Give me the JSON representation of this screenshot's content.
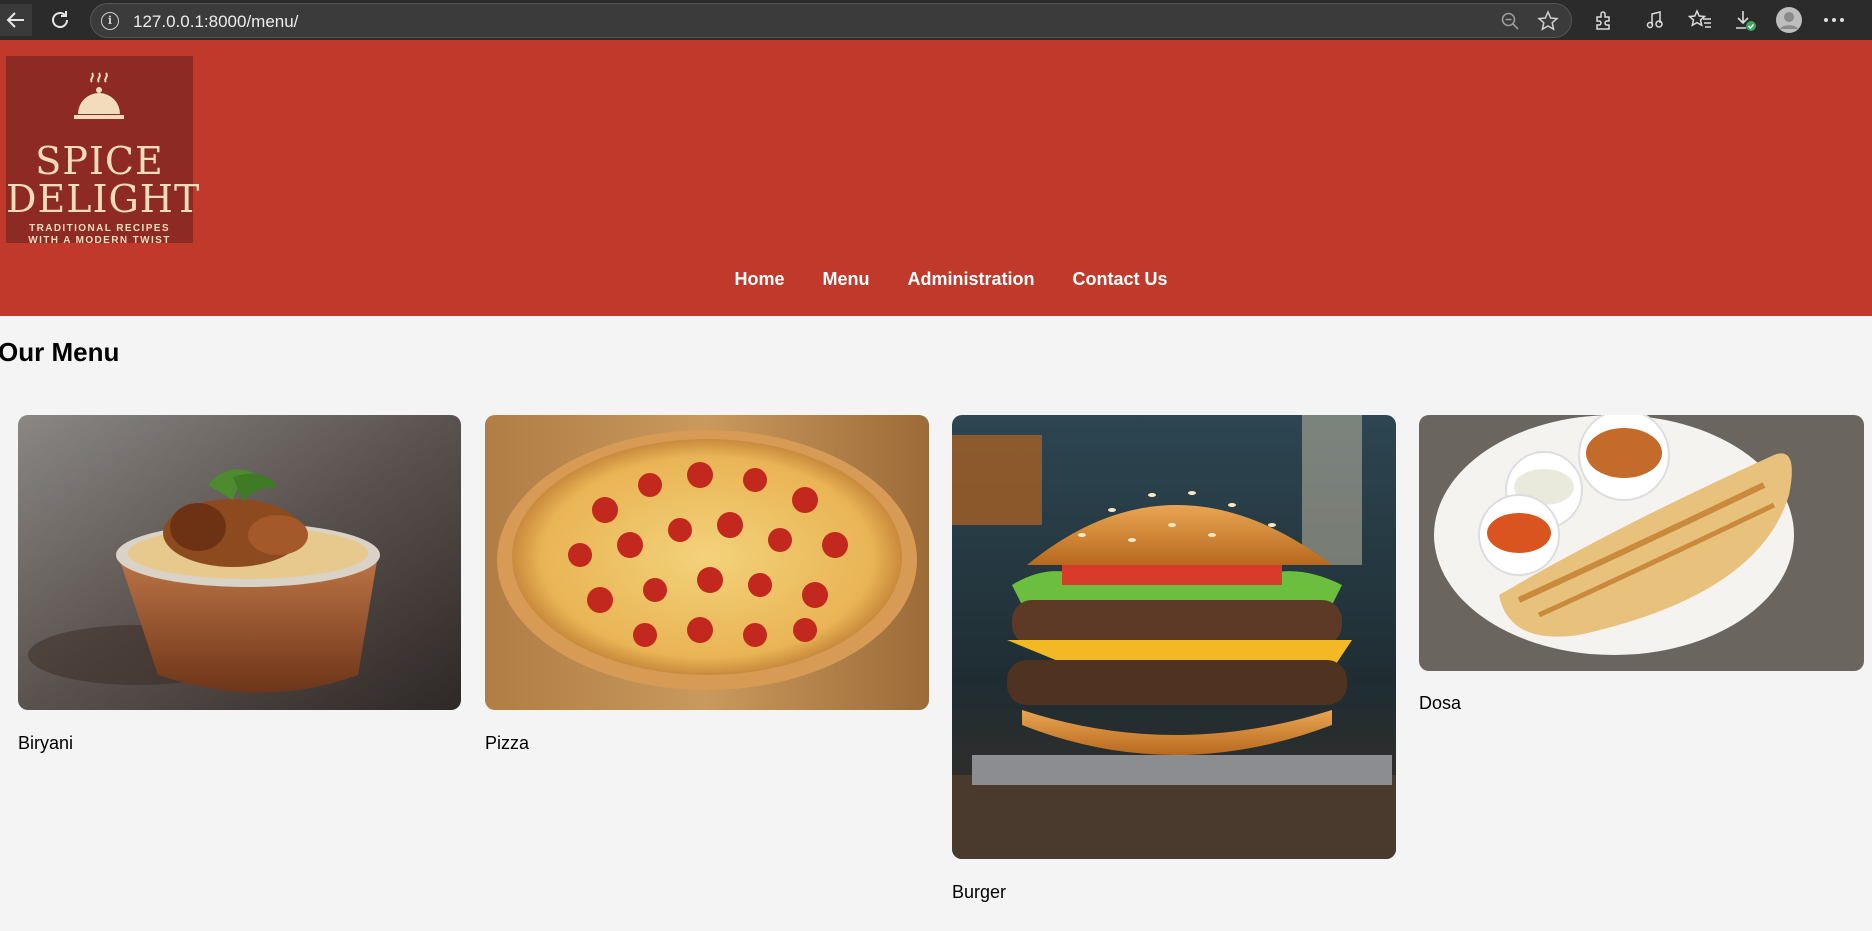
{
  "browser": {
    "url": "127.0.0.1:8000/menu/"
  },
  "logo": {
    "line1": "SPICE",
    "line2": "DELIGHT",
    "tagline1": "TRADITIONAL RECIPES",
    "tagline2": "WITH A MODERN TWIST"
  },
  "nav": {
    "items": [
      {
        "label": "Home"
      },
      {
        "label": "Menu"
      },
      {
        "label": "Administration"
      },
      {
        "label": "Contact Us"
      }
    ]
  },
  "page": {
    "title": "Our Menu"
  },
  "menu": {
    "items": [
      {
        "name": "Biryani",
        "image": "biryani-photo"
      },
      {
        "name": "Pizza",
        "image": "pizza-photo"
      },
      {
        "name": "Burger",
        "image": "burger-photo"
      },
      {
        "name": "Dosa",
        "image": "dosa-photo"
      }
    ]
  },
  "colors": {
    "header_red": "#c0392b",
    "logo_red": "#8e2a24",
    "page_bg": "#f4f4f4",
    "browser_dark": "#2b2b2b"
  }
}
